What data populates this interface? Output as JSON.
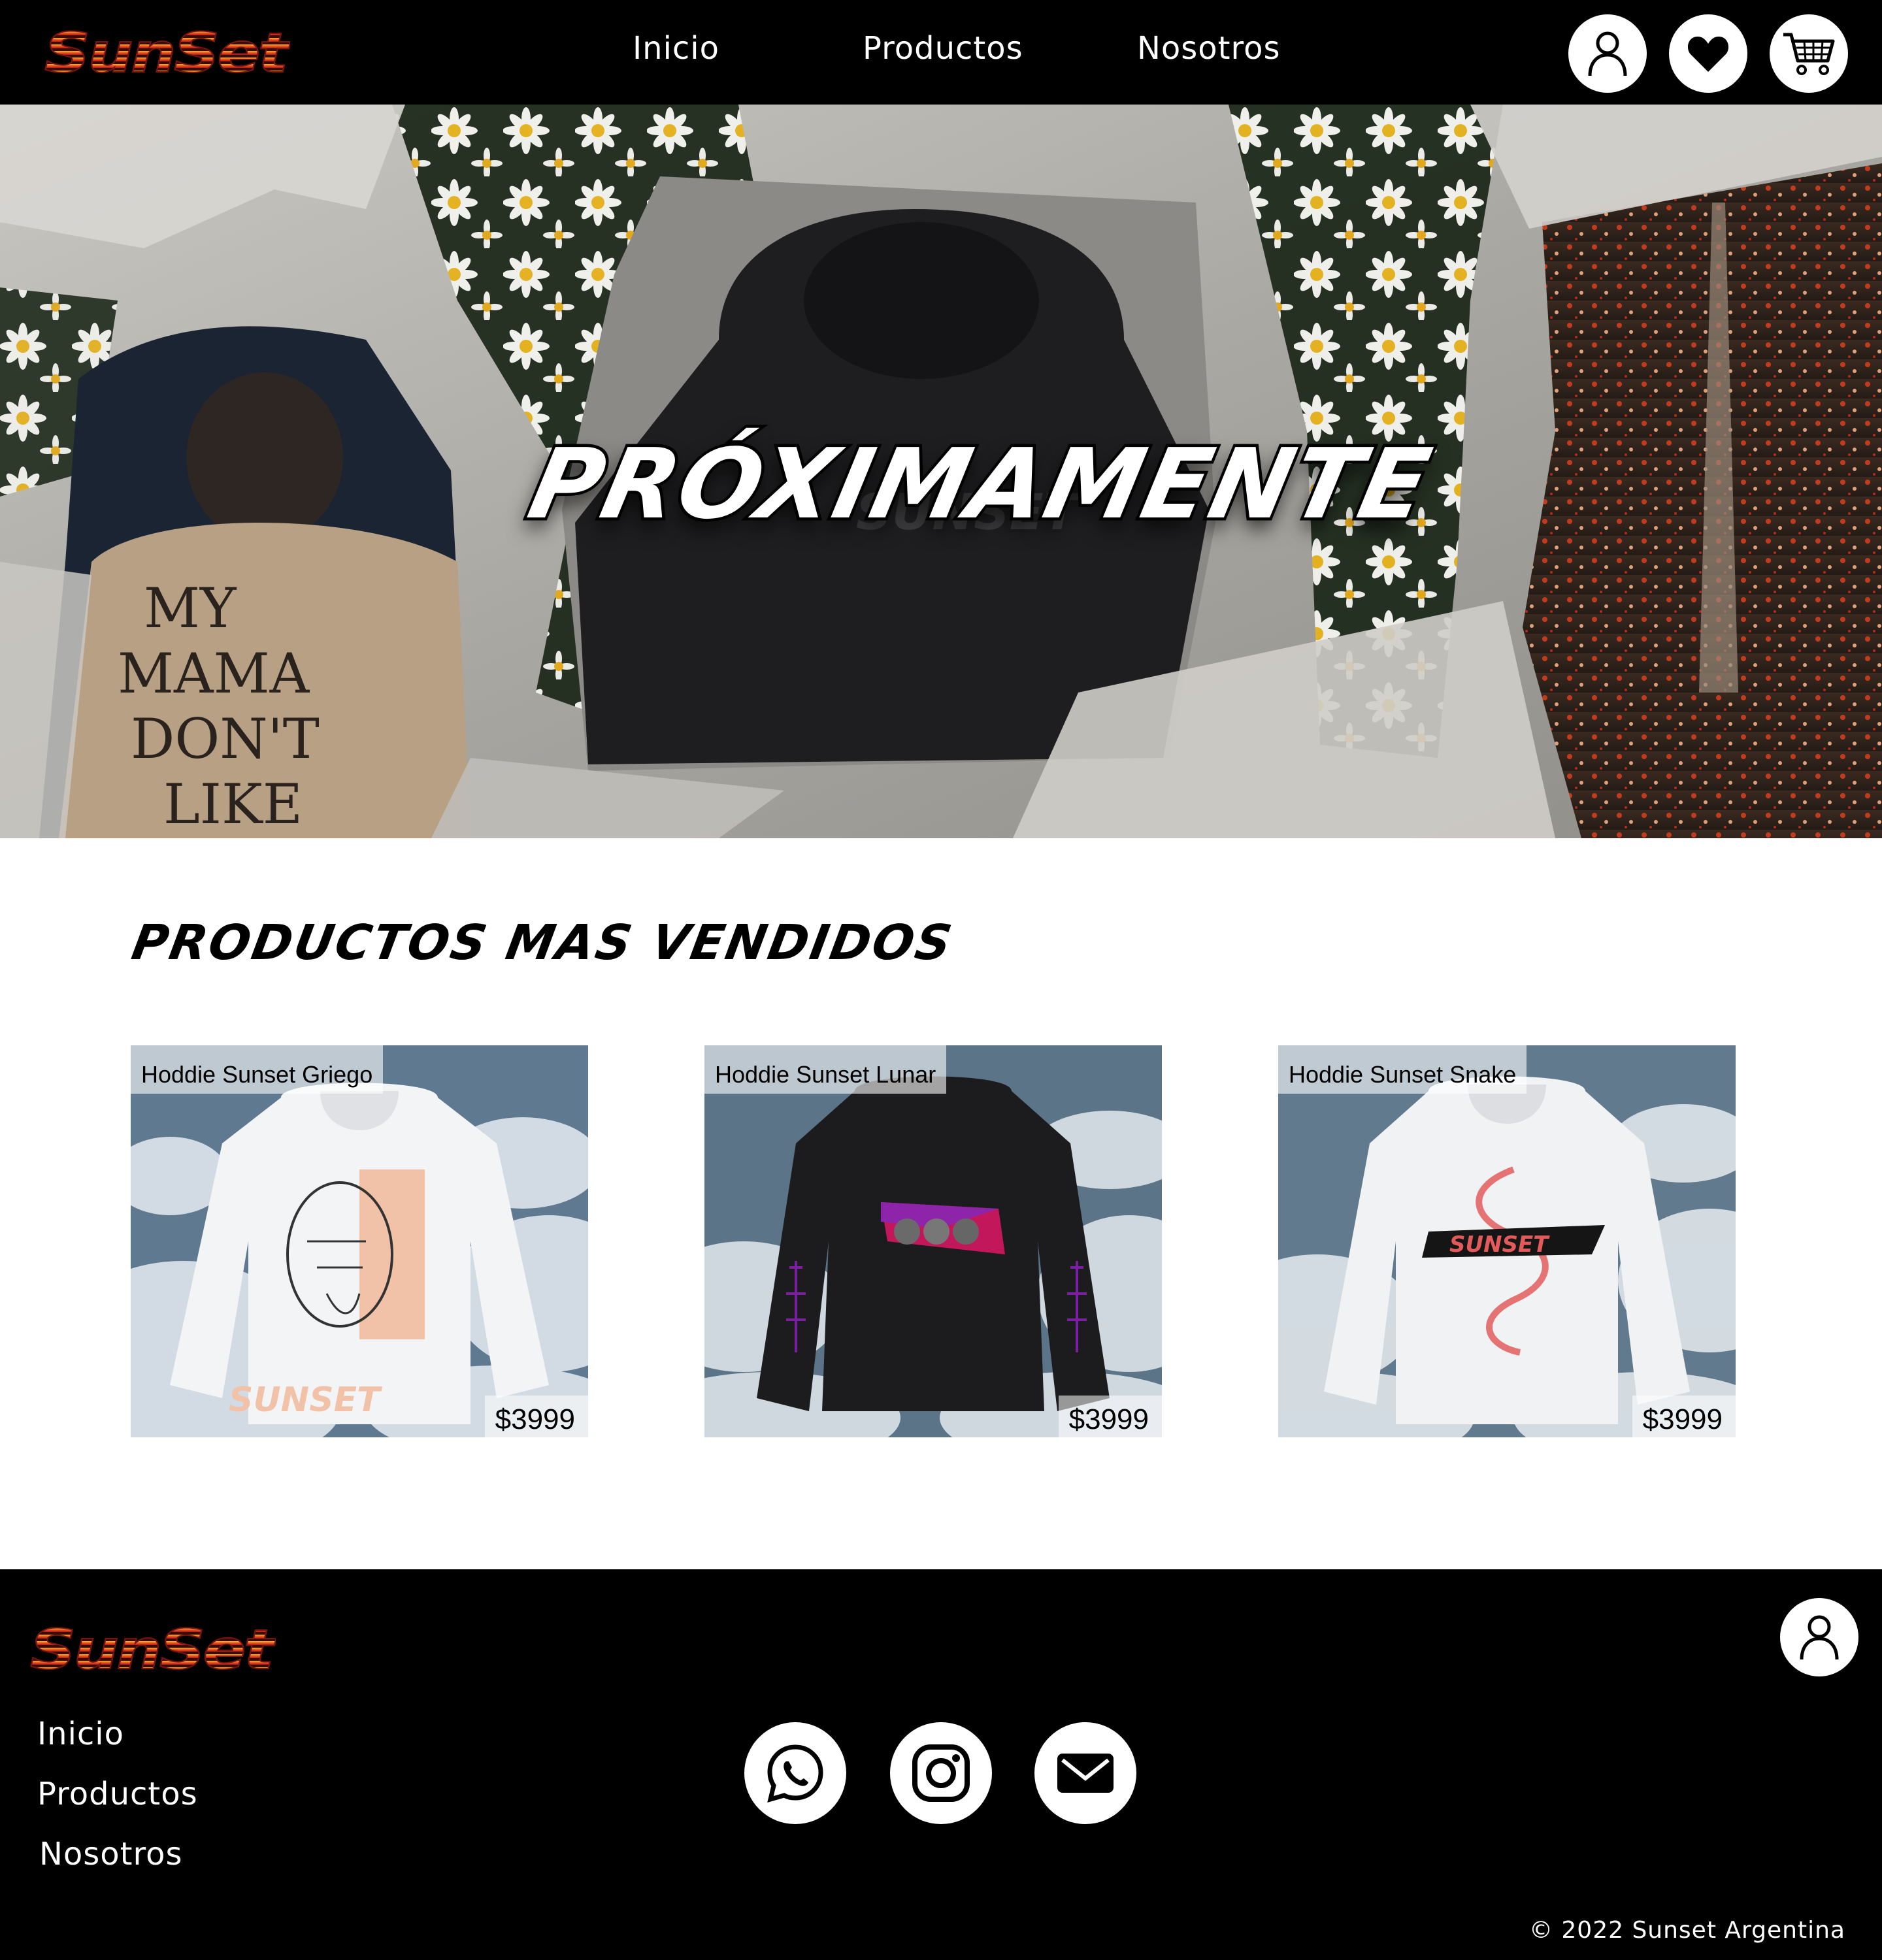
{
  "brand": {
    "name": "SunSet"
  },
  "nav": {
    "items": [
      "Inicio",
      "Productos",
      "Nosotros"
    ]
  },
  "header_icons": [
    "user-icon",
    "heart-icon",
    "cart-icon"
  ],
  "hero": {
    "title": "PRÓXIMAMENTE",
    "shirt_print": [
      "MY",
      "MAMA",
      "DON'T",
      "LIKE"
    ],
    "hoodie_print": "SUNSET"
  },
  "featured": {
    "title": "PRODUCTOS MAS VENDIDOS",
    "products": [
      {
        "name": "Hoddie Sunset Griego",
        "price": "$3999",
        "graphic_text": "SUNSET"
      },
      {
        "name": "Hoddie Sunset Lunar",
        "price": "$3999",
        "graphic_text": ""
      },
      {
        "name": "Hoddie Sunset Snake",
        "price": "$3999",
        "graphic_text": "SUNSET"
      }
    ]
  },
  "footer": {
    "nav": [
      "Inicio",
      "Productos",
      "Nosotros"
    ],
    "social_icons": [
      "whatsapp-icon",
      "instagram-icon",
      "mail-icon"
    ],
    "copyright": "© 2022 Sunset Argentina"
  },
  "colors": {
    "header_bg": "#000000",
    "logo_red": "#d7261e",
    "logo_orange": "#f09a2a",
    "footer_bg": "#000000"
  }
}
